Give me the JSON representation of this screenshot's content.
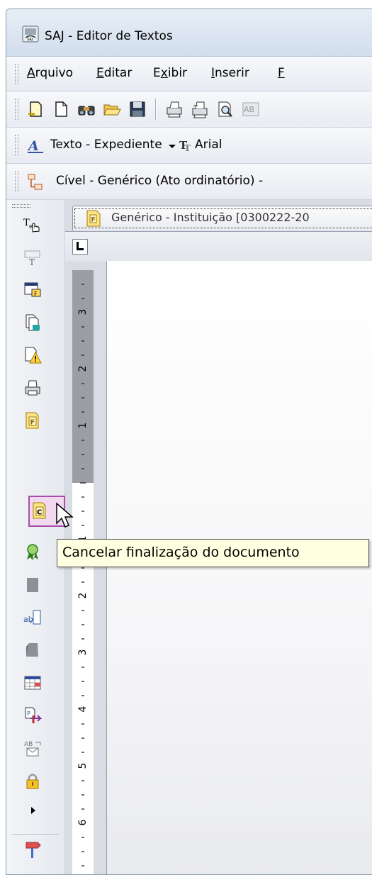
{
  "window": {
    "title": "SAJ - Editor de Textos"
  },
  "menu": {
    "items": [
      {
        "pre": "",
        "key": "A",
        "post": "rquivo"
      },
      {
        "pre": "",
        "key": "E",
        "post": "ditar"
      },
      {
        "pre": "E",
        "key": "x",
        "post": "ibir"
      },
      {
        "pre": "",
        "key": "I",
        "post": "nserir"
      },
      {
        "pre": "",
        "key": "F",
        "post": ""
      }
    ]
  },
  "toolbar2": {
    "style_value": "Texto - Expediente",
    "font_value": "Arial"
  },
  "toolbar3": {
    "model_value": "Cível - Genérico (Ato ordinatório) -"
  },
  "document": {
    "tab_label": "Genérico - Instituição [0300222-20"
  },
  "ruler": {
    "labels": [
      "3",
      "2",
      "1",
      "1",
      "2",
      "3",
      "4",
      "5",
      "6"
    ]
  },
  "tooltip": {
    "text": "Cancelar finalização do documento"
  },
  "colors": {
    "titlebar": "#dbe5f1",
    "tooltip_bg": "#ffffe1",
    "highlight": "#a74ea8"
  }
}
